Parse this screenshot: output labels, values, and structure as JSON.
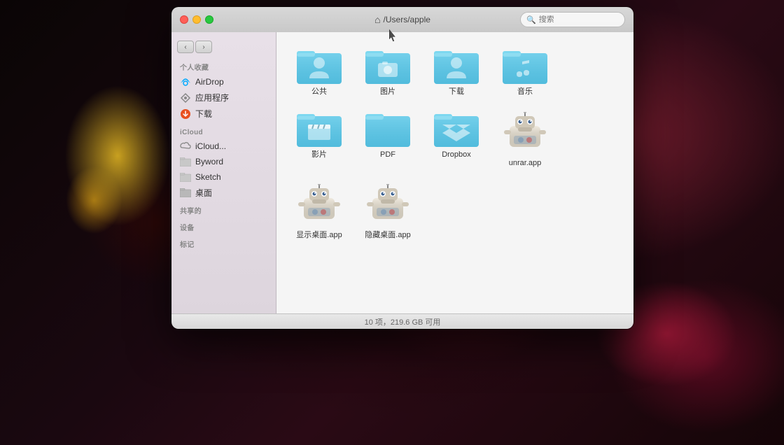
{
  "window": {
    "title": "⌂ /Users/apple",
    "title_icon": "⌂",
    "title_path": "/Users/apple",
    "search_placeholder": "搜索"
  },
  "traffic_lights": {
    "close": "close",
    "minimize": "minimize",
    "maximize": "maximize"
  },
  "sidebar": {
    "sections": [
      {
        "label": "个人收藏",
        "items": [
          {
            "id": "airdrop",
            "label": "AirDrop",
            "icon": "airdrop"
          },
          {
            "id": "apps",
            "label": "应用程序",
            "icon": "apps"
          },
          {
            "id": "downloads",
            "label": "下载",
            "icon": "downloads"
          }
        ]
      },
      {
        "label": "iCloud",
        "items": [
          {
            "id": "icloud-drive",
            "label": "iCloud...",
            "icon": "icloud"
          },
          {
            "id": "byword",
            "label": "Byword",
            "icon": "byword"
          },
          {
            "id": "sketch",
            "label": "Sketch",
            "icon": "sketch"
          },
          {
            "id": "desktop",
            "label": "桌面",
            "icon": "desktop"
          }
        ]
      },
      {
        "label": "共享的",
        "items": []
      },
      {
        "label": "设备",
        "items": []
      },
      {
        "label": "标记",
        "items": []
      }
    ]
  },
  "files": [
    {
      "id": "public",
      "label": "公共",
      "type": "folder",
      "variant": "public"
    },
    {
      "id": "pictures",
      "label": "图片",
      "type": "folder",
      "variant": "pictures"
    },
    {
      "id": "downloads",
      "label": "下载",
      "type": "folder",
      "variant": "downloads"
    },
    {
      "id": "music",
      "label": "音乐",
      "type": "folder",
      "variant": "music"
    },
    {
      "id": "movies",
      "label": "影片",
      "type": "folder",
      "variant": "movies"
    },
    {
      "id": "pdf",
      "label": "PDF",
      "type": "folder",
      "variant": "plain"
    },
    {
      "id": "dropbox",
      "label": "Dropbox",
      "type": "folder",
      "variant": "dropbox"
    },
    {
      "id": "unrar",
      "label": "unrar.app",
      "type": "app",
      "variant": "automator"
    },
    {
      "id": "show-desktop",
      "label": "显示桌面.app",
      "type": "app",
      "variant": "automator"
    },
    {
      "id": "hide-desktop",
      "label": "隐藏桌面.app",
      "type": "app",
      "variant": "automator"
    }
  ],
  "status": {
    "text": "10 项，219.6 GB 可用"
  },
  "colors": {
    "folder_blue": "#5bc8e8",
    "folder_blue_dark": "#3aaccb",
    "folder_blue_tab": "#5bc8e8"
  }
}
